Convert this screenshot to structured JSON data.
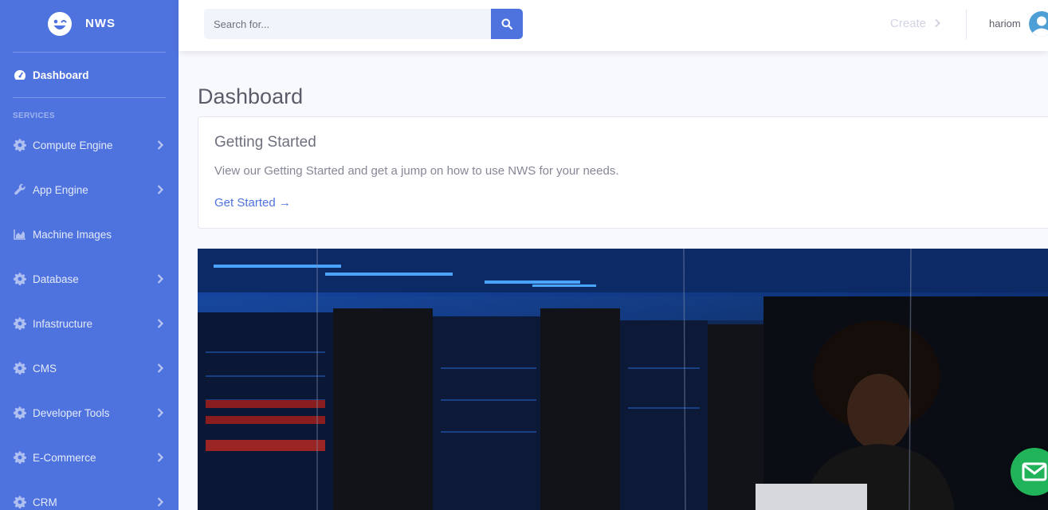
{
  "brand": {
    "name": "NWS"
  },
  "sidebar": {
    "dashboard": {
      "label": "Dashboard",
      "icon": "tachometer-icon"
    },
    "heading": "SERVICES",
    "items": [
      {
        "label": "Compute Engine",
        "icon": "gear-icon",
        "has_submenu": true
      },
      {
        "label": "App Engine",
        "icon": "wrench-icon",
        "has_submenu": true
      },
      {
        "label": "Machine Images",
        "icon": "area-chart-icon",
        "has_submenu": false
      },
      {
        "label": "Database",
        "icon": "gear-icon",
        "has_submenu": true
      },
      {
        "label": "Infastructure",
        "icon": "gear-icon",
        "has_submenu": true
      },
      {
        "label": "CMS",
        "icon": "gear-icon",
        "has_submenu": true
      },
      {
        "label": "Developer Tools",
        "icon": "gear-icon",
        "has_submenu": true
      },
      {
        "label": "E-Commerce",
        "icon": "gear-icon",
        "has_submenu": true
      },
      {
        "label": "CRM",
        "icon": "gear-icon",
        "has_submenu": true
      }
    ]
  },
  "topbar": {
    "search_placeholder": "Search for...",
    "create_label": "Create",
    "username": "hariom"
  },
  "main": {
    "title": "Dashboard",
    "card": {
      "title": "Getting Started",
      "text": "View our Getting Started and get a jump on how to use NWS for your needs.",
      "link": "Get Started →"
    }
  },
  "colors": {
    "primary": "#4e73df",
    "background": "#f8f9fc",
    "chat_button": "#21b35a"
  }
}
